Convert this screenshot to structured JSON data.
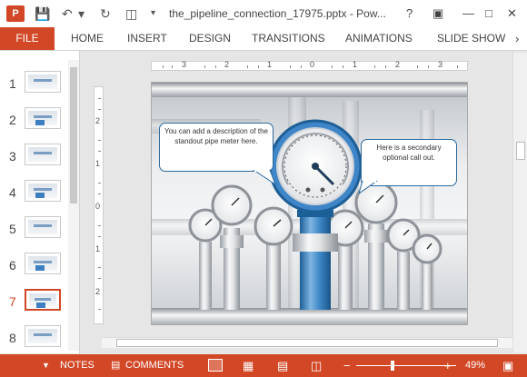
{
  "app": {
    "icon_label": "P"
  },
  "title_bar": {
    "title": "the_pipeline_connection_17975.pptx - Pow...",
    "help": "?"
  },
  "ribbon": {
    "file": "FILE",
    "tabs": [
      "HOME",
      "INSERT",
      "DESIGN",
      "TRANSITIONS",
      "ANIMATIONS",
      "SLIDE SHOW"
    ]
  },
  "thumbnails": {
    "items": [
      {
        "number": "1"
      },
      {
        "number": "2"
      },
      {
        "number": "3"
      },
      {
        "number": "4"
      },
      {
        "number": "5"
      },
      {
        "number": "6"
      },
      {
        "number": "7"
      },
      {
        "number": "8"
      }
    ],
    "active": "7"
  },
  "ruler": {
    "h_labels": [
      "3",
      "2",
      "1",
      "0",
      "1",
      "2",
      "3"
    ],
    "v_labels": [
      "2",
      "1",
      "0",
      "1",
      "2"
    ]
  },
  "slide": {
    "callout_left": "You can add a description of the standout pipe meter here.",
    "callout_right": "Here is a secondary optional call out."
  },
  "status": {
    "notes": "NOTES",
    "comments": "COMMENTS",
    "zoom": "49%",
    "zoom_minus": "−",
    "zoom_plus": "+"
  },
  "colors": {
    "accent": "#d24726",
    "pipe_blue": "#2f79b9"
  }
}
